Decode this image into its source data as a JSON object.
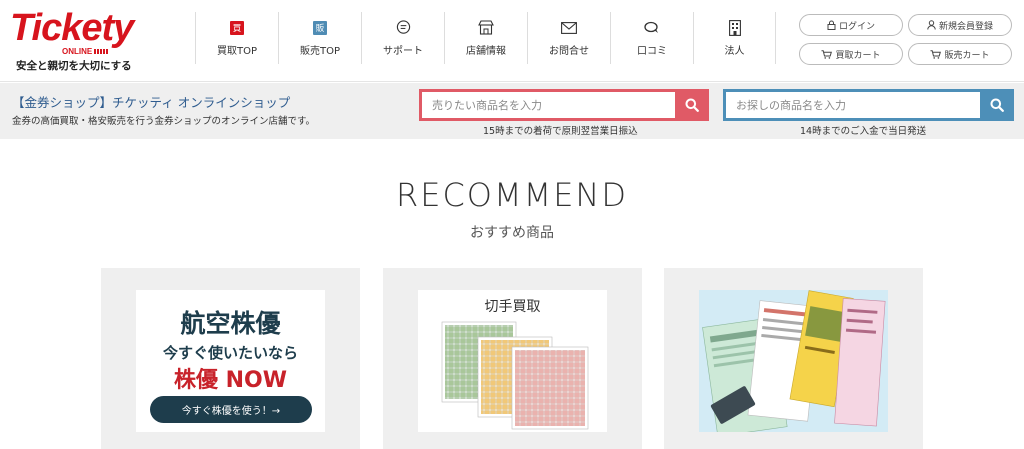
{
  "logo": {
    "name": "Tickety",
    "sub": "ONLINE",
    "tagline": "安全と親切を大切にする"
  },
  "nav": [
    {
      "label": "買取TOP",
      "badge": "買",
      "icon": "buy-badge-icon"
    },
    {
      "label": "販売TOP",
      "badge": "販",
      "icon": "sell-badge-icon"
    },
    {
      "label": "サポート",
      "icon": "support-chat-icon"
    },
    {
      "label": "店舗情報",
      "icon": "store-icon"
    },
    {
      "label": "お問合せ",
      "icon": "mail-icon"
    },
    {
      "label": "口コミ",
      "icon": "review-bubble-icon"
    },
    {
      "label": "法人",
      "icon": "building-icon"
    }
  ],
  "account": {
    "login": "ログイン",
    "register": "新規会員登録",
    "buy_cart": "買取カート",
    "sell_cart": "販売カート"
  },
  "band": {
    "shop_title": "【金券ショップ】チケッティ オンラインショップ",
    "shop_desc": "金券の高価買取・格安販売を行う金券ショップのオンライン店舗です。",
    "sell_placeholder": "売りたい商品名を入力",
    "buy_placeholder": "お探しの商品名を入力",
    "sell_note": "15時までの着荷で原則翌営業日振込",
    "buy_note": "14時までのご入金で当日発送"
  },
  "recommend": {
    "title": "RECOMMEND",
    "subtitle": "おすすめ商品",
    "cards": [
      {
        "line1": "航空株優",
        "line2": "今すぐ使いたいなら",
        "line3": "株優 NOW",
        "button": "今すぐ株優を使う！→"
      },
      {
        "title": "切手買取"
      },
      {
        "image": "jr-tickets"
      }
    ]
  },
  "colors": {
    "brand_red": "#d7141d",
    "sell_accent": "#e05a66",
    "buy_accent": "#4d8fb8",
    "navy": "#1e3d4c"
  }
}
